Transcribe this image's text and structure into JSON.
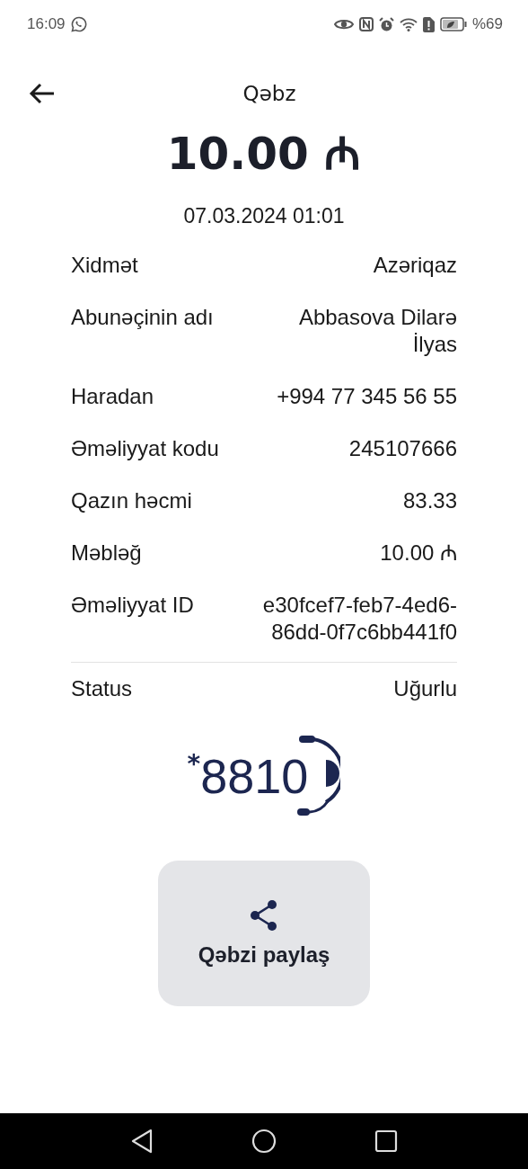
{
  "status_bar": {
    "time": "16:09",
    "battery": "%69"
  },
  "header": {
    "title": "Qəbz"
  },
  "amount": "10.00 ₼",
  "date": "07.03.2024 01:01",
  "details": [
    {
      "label": "Xidmət",
      "value": "Azəriqaz"
    },
    {
      "label": "Abunəçinin adı",
      "value": "Abbasova Dilarə İlyas"
    },
    {
      "label": "Haradan",
      "value": "+994 77 345 56 55"
    },
    {
      "label": "Əməliyyat kodu",
      "value": "245107666"
    },
    {
      "label": "Qazın həcmi",
      "value": "83.33"
    },
    {
      "label": "Məbləğ",
      "value": "10.00 ₼"
    },
    {
      "label": "Əməliyyat ID",
      "value": "e30fcef7-feb7-4ed6-86dd-0f7c6bb441f0"
    }
  ],
  "status": {
    "label": "Status",
    "value": "Uğurlu"
  },
  "logo": {
    "star": "*",
    "number": "8810"
  },
  "share_button": {
    "label": "Qəbzi paylaş"
  }
}
